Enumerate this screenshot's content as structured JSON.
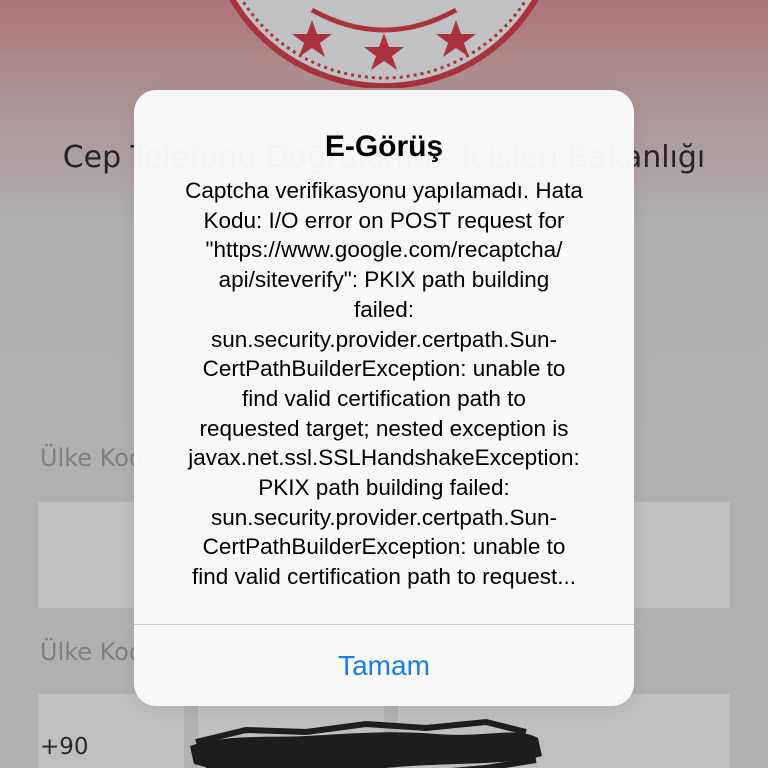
{
  "background": {
    "title": "Cep Telefonu Doğrulama - İçişleri Bakanlığı",
    "country_code_label": "Ülke Kodu",
    "phone_label": "Ülke Kodu",
    "country_prefix": "+90"
  },
  "alert": {
    "title": "E-Görüş",
    "message_lines": [
      "Captcha verifikasyonu yapılamadı. Hata",
      "Kodu: I/O error on POST request for",
      "\"https://www.google.com/recaptcha/",
      "api/siteverify\": PKIX path building",
      "failed:",
      "sun.security.provider.certpath.Sun-",
      "CertPathBuilderException: unable to",
      "find valid certification path to",
      "requested target; nested exception is",
      "javax.net.ssl.SSLHandshakeException:",
      "PKIX path building failed:",
      "sun.security.provider.certpath.Sun-",
      "CertPathBuilderException: unable to",
      "find valid certification path to request..."
    ],
    "button_label": "Tamam",
    "button_color": "#1a7ce8"
  },
  "colors": {
    "emblem_red": "#d32f3a",
    "dim_overlay": "rgba(60,60,67,0.28)"
  },
  "icons": {
    "emblem": "ministry-seal-icon",
    "redaction": "scribble-redaction"
  }
}
